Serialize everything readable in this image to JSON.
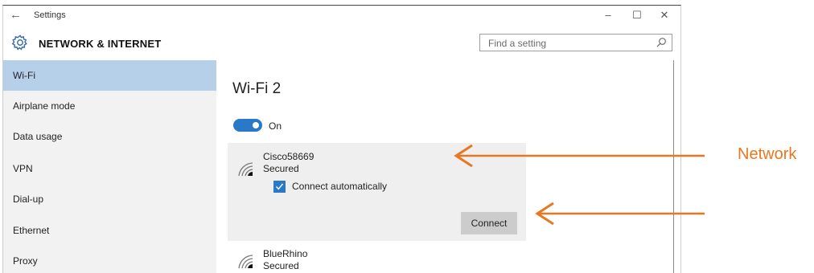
{
  "window": {
    "title": "Settings",
    "back_icon": "back-arrow-icon",
    "minimize_glyph": "–",
    "maximize_glyph": "☐",
    "close_glyph": "✕"
  },
  "header": {
    "section_title": "NETWORK & INTERNET",
    "icon": "gear-icon",
    "search_placeholder": "Find a setting"
  },
  "sidebar": {
    "items": [
      {
        "label": "Wi-Fi",
        "selected": true
      },
      {
        "label": "Airplane mode"
      },
      {
        "label": "Data usage"
      },
      {
        "label": "VPN"
      },
      {
        "label": "Dial-up"
      },
      {
        "label": "Ethernet"
      },
      {
        "label": "Proxy"
      }
    ]
  },
  "main": {
    "heading": "Wi-Fi 2",
    "toggle_label": "On",
    "networks": [
      {
        "name": "Cisco58669",
        "status": "Secured",
        "auto_connect_label": "Connect automatically",
        "connect_label": "Connect",
        "icon": "wifi-signal-icon"
      },
      {
        "name": "BlueRhino",
        "status": "Secured",
        "icon": "wifi-signal-icon"
      }
    ]
  },
  "annotation": {
    "label": "Network",
    "color": "#e87722"
  },
  "colors": {
    "accent": "#2a79c9",
    "selected_nav": "#b7d0e9",
    "sidebar_bg": "#f2f2f2",
    "card_bg": "#efefef"
  }
}
